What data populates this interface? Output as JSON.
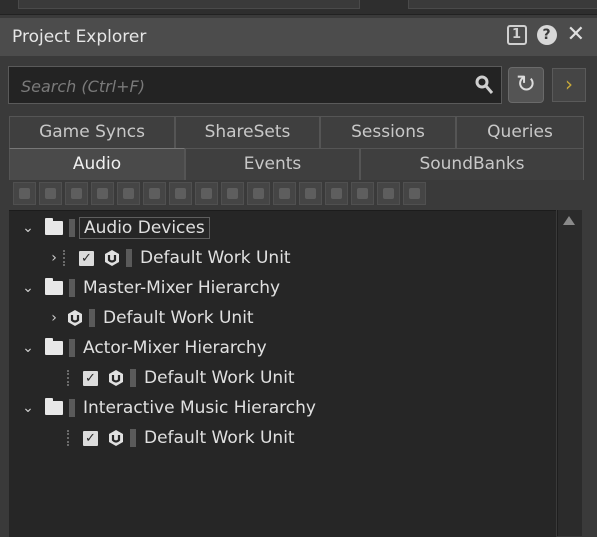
{
  "window": {
    "title": "Project Explorer",
    "pin_label": "1",
    "help_label": "?",
    "close_label": "✕"
  },
  "search": {
    "placeholder": "Search (Ctrl+F)",
    "value": "",
    "refresh_glyph": "↻",
    "go_glyph": "›"
  },
  "tabs": {
    "row1": [
      "Game Syncs",
      "ShareSets",
      "Sessions",
      "Queries"
    ],
    "row2": [
      "Audio",
      "Events",
      "SoundBanks"
    ],
    "active": "Audio"
  },
  "toolbar": {
    "tools": [
      "work-unit-icon",
      "folder-icon",
      "virtual-folder-icon",
      "actor-mixer-icon",
      "random-container-icon",
      "sequence-container-icon",
      "switch-container-icon",
      "blend-container-icon",
      "sound-sfx-icon",
      "voice-icon",
      "audio-bus-icon",
      "aux-bus-icon",
      "music-segment-icon",
      "music-track-icon",
      "music-playlist-icon",
      "music-switch-icon"
    ]
  },
  "tree": {
    "nodes": [
      {
        "label": "Audio Devices",
        "expanded": true,
        "selected": true
      },
      {
        "label": "Default Work Unit",
        "expanded": false,
        "checked": true
      },
      {
        "label": "Master-Mixer Hierarchy",
        "expanded": true
      },
      {
        "label": "Default Work Unit",
        "expanded": false
      },
      {
        "label": "Actor-Mixer Hierarchy",
        "expanded": true
      },
      {
        "label": "Default Work Unit",
        "checked": true
      },
      {
        "label": "Interactive Music Hierarchy",
        "expanded": true
      },
      {
        "label": "Default Work Unit",
        "checked": true
      }
    ]
  },
  "colors": {
    "background": "#3a3a3a",
    "tree_background": "#262626",
    "accent": "#c7a83a"
  }
}
